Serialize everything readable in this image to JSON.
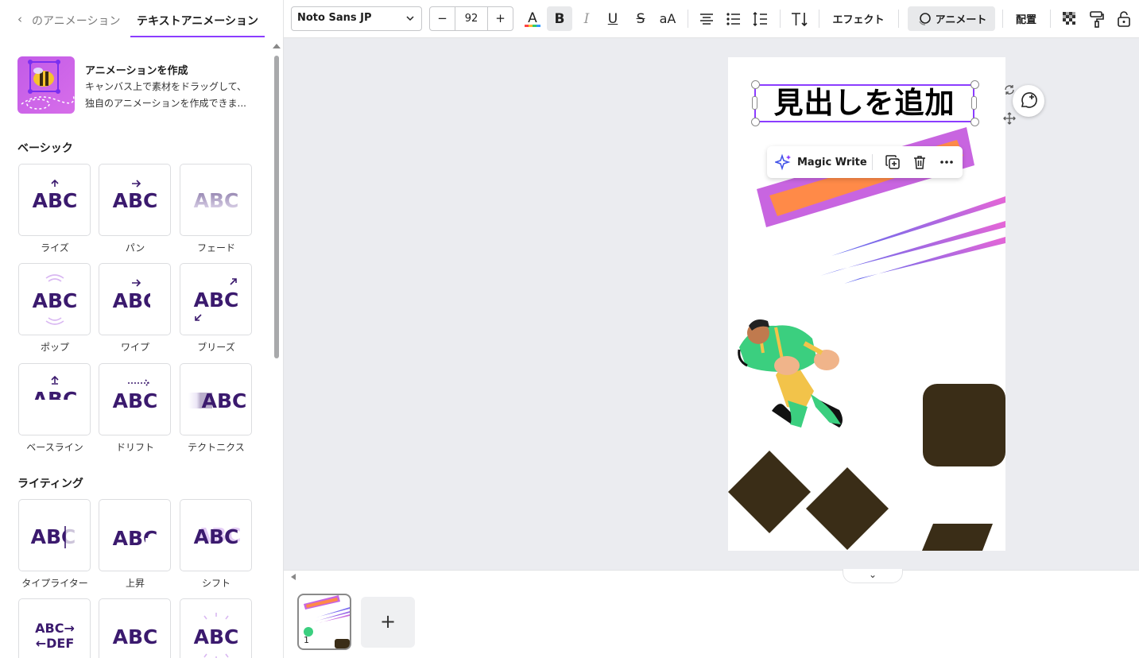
{
  "left_panel": {
    "tabs": {
      "back_label": "‹",
      "tab1_label": "のアニメーション",
      "tab2_label": "テキストアニメーション"
    },
    "create_animation": {
      "title": "アニメーションを作成",
      "desc_line1": "キャンバス上で素材をドラッグして、",
      "desc_line2": "独自のアニメーションを作成できま..."
    },
    "sections": {
      "basic": "ベーシック",
      "writing": "ライティング"
    },
    "basic_items": [
      "ライズ",
      "パン",
      "フェード",
      "ポップ",
      "ワイプ",
      "ブリーズ",
      "ベースライン",
      "ドリフト",
      "テクトニクス"
    ],
    "writing_items": [
      "タイプライター",
      "上昇",
      "シフト"
    ],
    "tile_text": "ABC",
    "tile_text_abc_def_1": "ABC→",
    "tile_text_abc_def_2": "←DEF"
  },
  "toolbar": {
    "font_name": "Noto Sans JP",
    "font_size": "92",
    "minus": "−",
    "plus": "+",
    "effects_label": "エフェクト",
    "animate_label": "アニメート",
    "position_label": "配置",
    "bold_glyph": "B",
    "italic_glyph": "I",
    "underline_glyph": "U",
    "strike_glyph": "S",
    "case_glyph": "aA",
    "text_color_glyph": "A",
    "icons": [
      "text-color-icon",
      "bold-icon",
      "italic-icon",
      "underline-icon",
      "strikethrough-icon",
      "case-icon",
      "align-center-icon",
      "list-icon",
      "spacing-icon",
      "vertical-text-icon",
      "transparency-icon",
      "paint-roller-icon",
      "lock-icon"
    ]
  },
  "canvas": {
    "heading_text": "見出しを追加",
    "context_menu": {
      "magic_write_label": "Magic Write",
      "icons": [
        "sparkle-icon",
        "duplicate-icon",
        "trash-icon",
        "more-icon"
      ]
    },
    "colors": {
      "accent": "#8b3dff",
      "purple_band": "#c865e0",
      "orange_band": "#ff8a48",
      "dark_shape": "#3a2d17"
    }
  },
  "bottom": {
    "page_number": "1",
    "add_page_label": "+",
    "collapse_glyph": "⌄"
  }
}
